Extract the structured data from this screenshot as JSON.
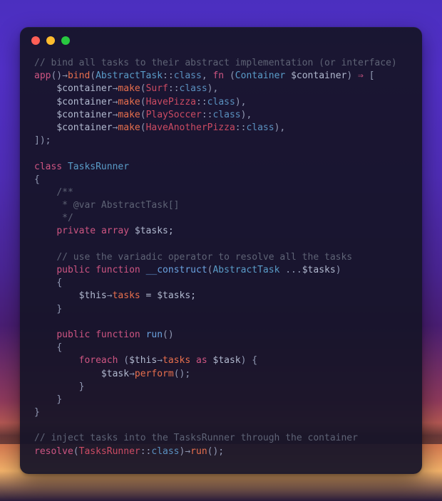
{
  "window": {
    "close_name": "close",
    "min_name": "minimize",
    "zoom_name": "zoom"
  },
  "colors": {
    "comment": "#5e6375",
    "keyword": "#ce5582",
    "function": "#e86f4d",
    "funcname": "#6aa2df",
    "type": "#5a9cc8",
    "impl": "#cc4b63",
    "symbol": "#9199b3",
    "variable": "#b1b9cf"
  },
  "code": {
    "comment_bind": "// bind all tasks to their abstract implementation (or interface)",
    "app": "app",
    "bind": "bind",
    "abstract_task": "AbstractTask",
    "class_kw_dbl": "::",
    "class_const": "class",
    "fn": "fn",
    "container_type": "Container",
    "container_var": "$container",
    "fat_arrow": "⇒",
    "thin_arrow": "→",
    "make": "make",
    "impl_surf": "Surf",
    "impl_havepizza": "HavePizza",
    "impl_playsoccer": "PlaySoccer",
    "impl_haveanotherpizza": "HaveAnotherPizza",
    "close_arr": "]);",
    "class_kw": "class",
    "tasks_runner": "TasksRunner",
    "brace_open": "{",
    "brace_close": "}",
    "doc_open": "/**",
    "doc_var_line": " * @var AbstractTask[]",
    "doc_close": " */",
    "private": "private",
    "array_kw": "array",
    "tasks_prop_decl": "$tasks;",
    "comment_variadic": "// use the variadic operator to resolve all the tasks",
    "public": "public",
    "function_kw": "function",
    "construct": "__construct",
    "variadic": "...",
    "tasks_param": "$tasks",
    "this": "$this",
    "tasks_prop": "tasks",
    "assign": " = $tasks;",
    "run": "run",
    "foreach": "foreach",
    "as": "as",
    "task_var": "$task",
    "perform": "perform",
    "empty_parens": "();",
    "comment_inject": "// inject tasks into the TasksRunner through the container",
    "resolve": "resolve",
    "run_call": "run"
  }
}
